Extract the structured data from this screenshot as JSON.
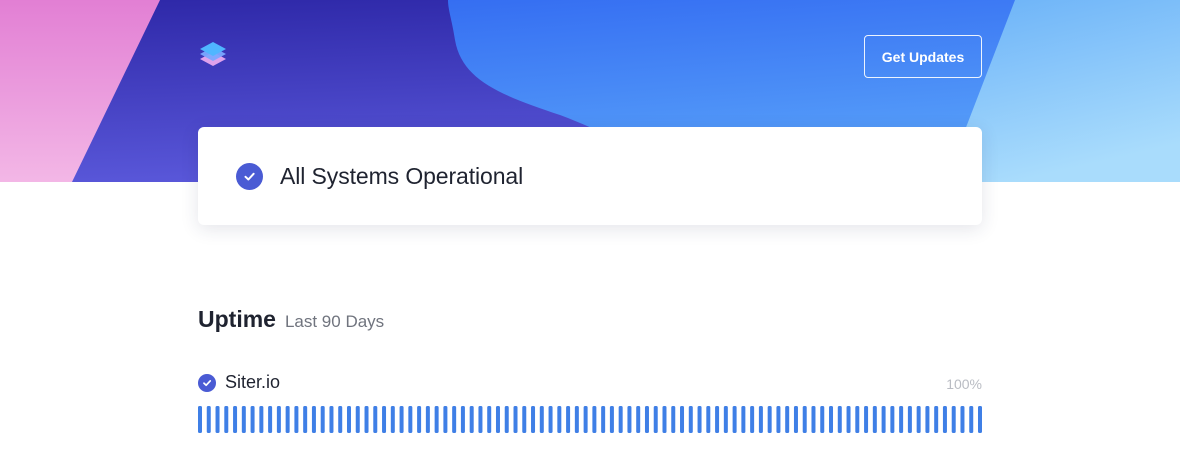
{
  "colors": {
    "accent": "#4a5bd4",
    "bar": "#3f7fe6",
    "hero_pink": "#ee90d8",
    "hero_indigo": "#3a34b8",
    "hero_blue": "#3d7cf5",
    "hero_sky": "#9cd4fb"
  },
  "header": {
    "logo_icon": "layers-icon",
    "cta_label": "Get Updates"
  },
  "status": {
    "icon": "check-circle-icon",
    "text": "All Systems Operational"
  },
  "uptime": {
    "title": "Uptime",
    "subtitle": "Last 90 Days",
    "services": [
      {
        "icon": "check-circle-icon",
        "name": "Siter.io",
        "percent": "100%",
        "days": 90,
        "day_status": "operational"
      }
    ]
  }
}
